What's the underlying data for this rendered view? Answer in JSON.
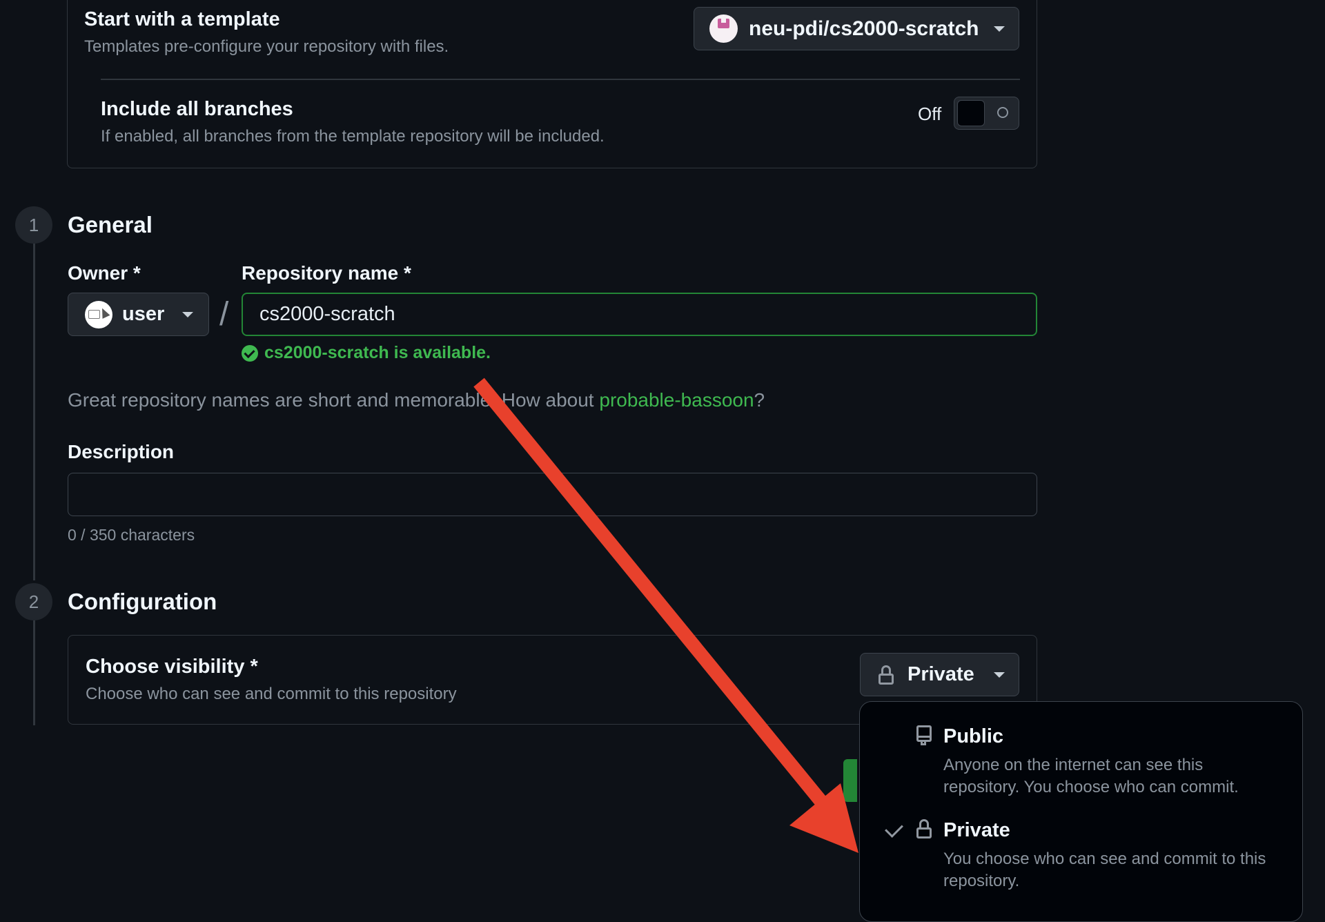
{
  "template": {
    "title": "Start with a template",
    "subtitle": "Templates pre-configure your repository with files.",
    "selected": "neu-pdi/cs2000-scratch"
  },
  "branches": {
    "title": "Include all branches",
    "subtitle": "If enabled, all branches from the template repository will be included.",
    "toggle_state": "Off"
  },
  "general": {
    "step": "1",
    "title": "General",
    "owner_label": "Owner *",
    "owner_value": "user",
    "repo_label": "Repository name *",
    "repo_value": "cs2000-scratch",
    "availability": "cs2000-scratch is available.",
    "suggestion_prefix": "Great repository names are short and memorable. How about ",
    "suggestion_name": "probable-bassoon",
    "suggestion_suffix": "?",
    "description_label": "Description",
    "description_value": "",
    "char_count": "0 / 350 characters"
  },
  "configuration": {
    "step": "2",
    "title": "Configuration",
    "visibility_label": "Choose visibility *",
    "visibility_subtitle": "Choose who can see and commit to this repository",
    "visibility_selected": "Private"
  },
  "visibility_menu": {
    "options": [
      {
        "title": "Public",
        "description": "Anyone on the internet can see this repository. You choose who can commit.",
        "icon": "repo-icon",
        "selected": false
      },
      {
        "title": "Private",
        "description": "You choose who can see and commit to this repository.",
        "icon": "lock-icon",
        "selected": true
      }
    ]
  },
  "colors": {
    "background": "#0d1117",
    "success": "#3fb950",
    "annotation_arrow": "#e8412c"
  }
}
